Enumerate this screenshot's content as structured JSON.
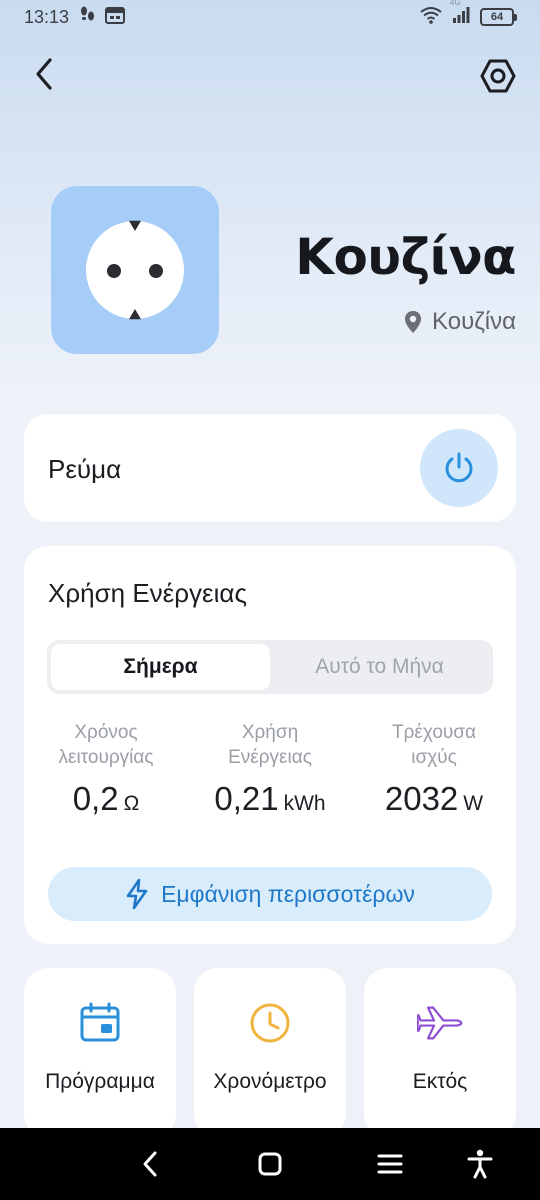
{
  "status_bar": {
    "time": "13:13",
    "network": "4G",
    "battery": "64"
  },
  "header": {
    "back_icon": "chevron-left-icon",
    "settings_icon": "hexagon-settings-icon"
  },
  "device": {
    "name": "Κουζίνα",
    "room": "Κουζίνα",
    "icon": "power-socket-icon",
    "icon_bg_color": "#a6cdf7"
  },
  "power": {
    "label": "Ρεύμα",
    "icon": "power-icon",
    "accent_color": "#2a8fdc"
  },
  "energy": {
    "title": "Χρήση Ενέργειας",
    "tabs": [
      {
        "label": "Σήμερα",
        "active": true
      },
      {
        "label": "Αυτό το Μήνα",
        "active": false
      }
    ],
    "stats": [
      {
        "label_line1": "Χρόνος",
        "label_line2": "λειτουργίας",
        "value": "0,2",
        "unit": "Ω"
      },
      {
        "label_line1": "Χρήση",
        "label_line2": "Ενέργειας",
        "value": "0,21",
        "unit": "kWh"
      },
      {
        "label_line1": "Τρέχουσα",
        "label_line2": "ισχύς",
        "value": "2032",
        "unit": "W"
      }
    ],
    "more_label": "Εμφάνιση περισσοτέρων",
    "more_icon": "lightning-icon"
  },
  "tiles": [
    {
      "label": "Πρόγραμμα",
      "icon": "calendar-icon",
      "color": "#2a8fdc"
    },
    {
      "label": "Χρονόμετρο",
      "icon": "clock-icon",
      "color": "#f0b33e"
    },
    {
      "label": "Εκτός",
      "icon": "airplane-icon",
      "color": "#8e4fd6"
    }
  ],
  "nav": {
    "back": "nav-back-icon",
    "home": "nav-home-icon",
    "menu": "nav-menu-icon",
    "accessibility": "accessibility-icon"
  }
}
